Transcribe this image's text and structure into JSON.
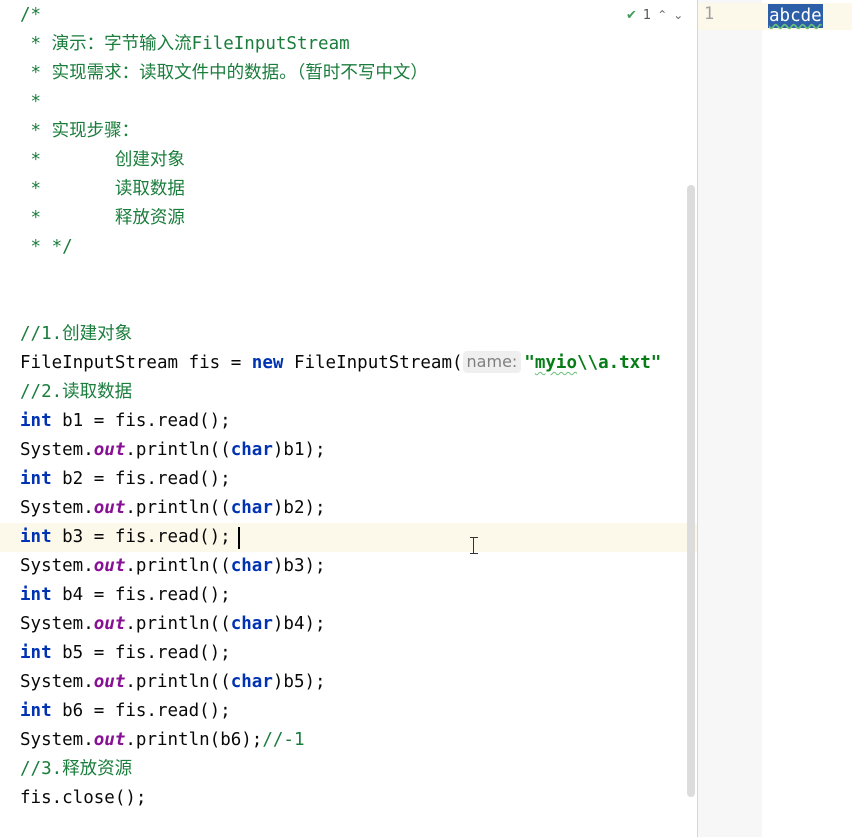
{
  "editor": {
    "inspection": {
      "count": "1"
    },
    "comment": {
      "open": "/*",
      "line1_prefix": " * 演示：字节输入流",
      "line1_class": "FileInputStream",
      "line2": " * 实现需求：读取文件中的数据。（暂时不写中文）",
      "line3": " *",
      "line4": " * 实现步骤：",
      "step1": " *       创建对象",
      "step2": " *       读取数据",
      "step3": " *       释放资源",
      "close": " * */"
    },
    "code": {
      "c1": "//1.创建对象",
      "fis_decl_prefix": "FileInputStream fis = ",
      "new_kw": "new",
      "fis_decl_ctor": " FileInputStream(",
      "param_hint": "name:",
      "string_quote_open": "\"",
      "string_path_sq": "myio",
      "string_path_rest": "\\\\a.txt\"",
      "c2": "//2.读取数据",
      "int_kw": "int",
      "system": "System.",
      "out": "out",
      "println_open": ".println((",
      "char_kw": "char",
      "b1_decl": " b1 = fis.read();",
      "b1_print": ")b1);",
      "b2_decl": " b2 = fis.read();",
      "b2_print": ")b2);",
      "b3_decl": " b3 = fis.read();",
      "b3_print": ")b3);",
      "b4_decl": " b4 = fis.read();",
      "b4_print": ")b4);",
      "b5_decl": " b5 = fis.read();",
      "b5_print": ")b5);",
      "b6_decl": " b6 = fis.read();",
      "b6_print_mid": ".println(b6);",
      "b6_comment": "//-1",
      "c3": "//3.释放资源",
      "close": "fis.close();"
    }
  },
  "file_pane": {
    "line_number": "1",
    "content": "abcde"
  },
  "colors": {
    "comment": "#1a7d3c",
    "keyword": "#0033b3",
    "field": "#871094",
    "string": "#067d17",
    "current_line": "#fcf8ea",
    "selection": "#2d5ea8"
  }
}
